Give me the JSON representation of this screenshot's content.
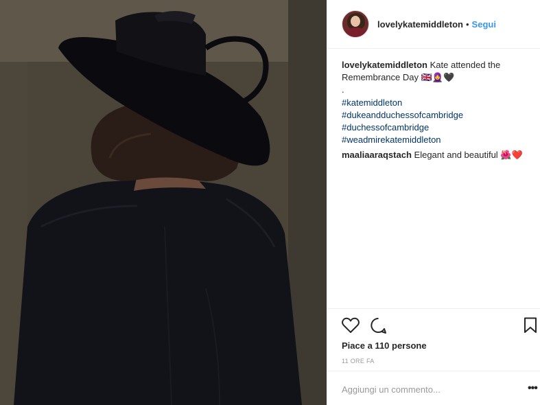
{
  "post": {
    "photo_alt": "",
    "username": "lovelykatemiddleton",
    "follow_label": "Segui",
    "separator": "•"
  },
  "caption": {
    "username": "lovelykatemiddleton",
    "text": "Kate attended the Remembrance Day 🇬🇧🧕🖤",
    "dot": ".",
    "hashtags": [
      "#katemiddleton",
      "#dukeandduchessofcambridge",
      "#duchessofcambridge",
      "#weadmirekatemiddleton"
    ]
  },
  "comment": {
    "username": "maaliaaraqstach",
    "text": "Elegant and beautiful 🌺❤️"
  },
  "actions": {
    "like_icon": "heart-outline-icon",
    "comment_icon": "speech-bubble-icon",
    "save_icon": "bookmark-icon",
    "likes_text": "Piace a 110 persone",
    "timestamp": "11 ORE FA",
    "comment_placeholder": "Aggiungi un commento...",
    "more_icon": "ellipsis-icon",
    "more_label": "•••"
  },
  "colors": {
    "follow": "#3897f0",
    "hashtag": "#003569",
    "muted": "#999999",
    "text": "#262626"
  }
}
